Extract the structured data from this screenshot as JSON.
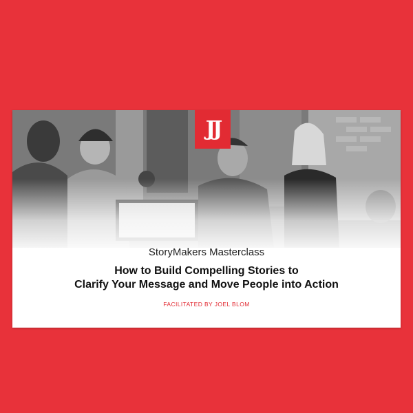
{
  "card": {
    "logo_text": "JJ",
    "logo_color": "#e22b33",
    "eyebrow": "StoryMakers Masterclass",
    "headline_line1": "How to Build Compelling Stories to",
    "headline_line2": "Clarify Your Message and Move People into Action",
    "facilitator": "FACILITATED BY JOEL BLOM"
  },
  "colors": {
    "background": "#e8323a",
    "accent": "#e22b33",
    "text": "#111111"
  }
}
